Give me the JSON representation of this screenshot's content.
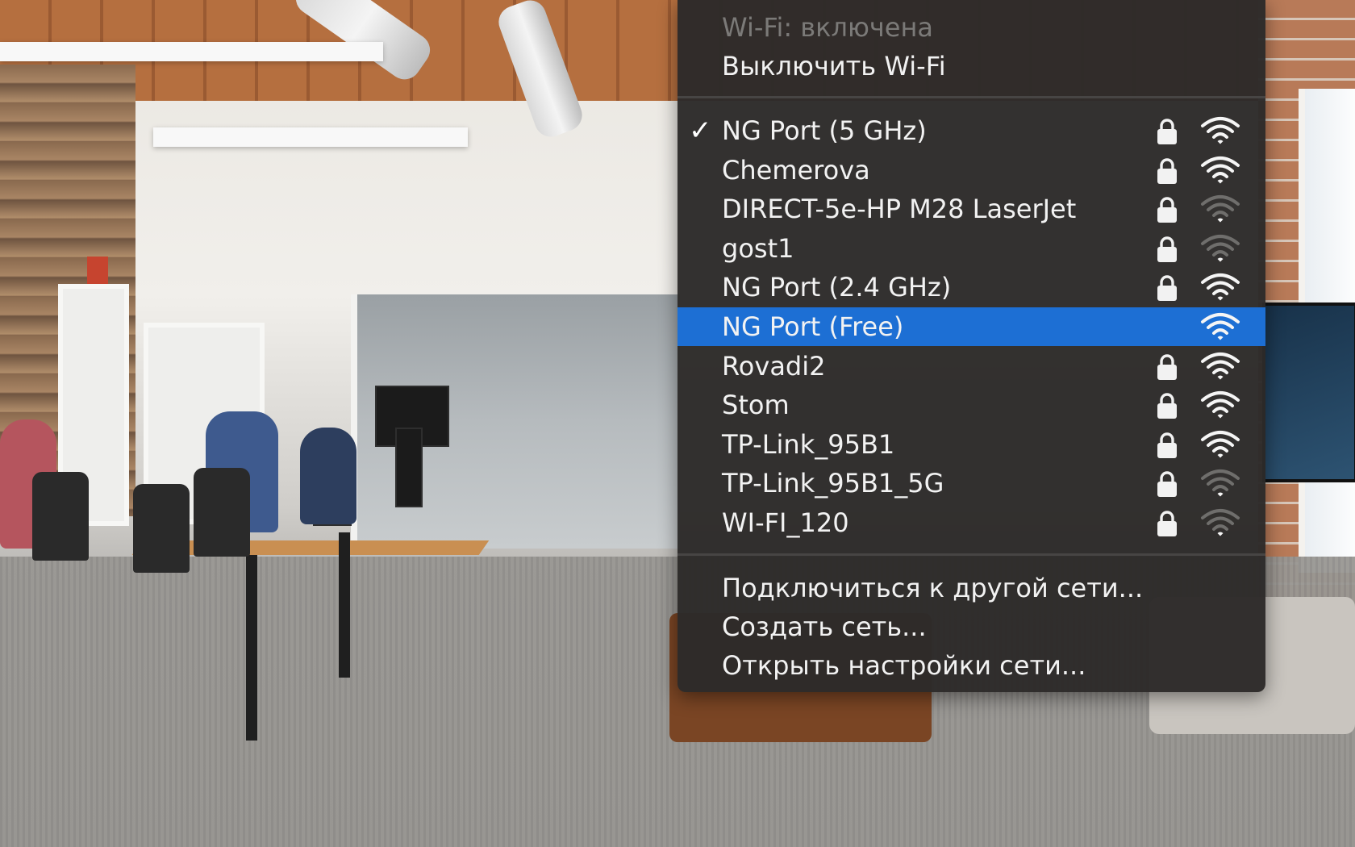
{
  "menu": {
    "status": "Wi-Fi: включена",
    "turn_off": "Выключить Wi-Fi",
    "networks": [
      {
        "name": "NG Port (5 GHz)",
        "connected": true,
        "locked": true,
        "signal": 4
      },
      {
        "name": "Chemerova",
        "connected": false,
        "locked": true,
        "signal": 4
      },
      {
        "name": "DIRECT-5e-HP M28 LaserJet",
        "connected": false,
        "locked": true,
        "signal": 1
      },
      {
        "name": "gost1",
        "connected": false,
        "locked": true,
        "signal": 1
      },
      {
        "name": "NG Port (2.4 GHz)",
        "connected": false,
        "locked": true,
        "signal": 4
      },
      {
        "name": "NG Port (Free)",
        "connected": false,
        "locked": false,
        "signal": 4,
        "highlighted": true
      },
      {
        "name": "Rovadi2",
        "connected": false,
        "locked": true,
        "signal": 4
      },
      {
        "name": "Stom",
        "connected": false,
        "locked": true,
        "signal": 4
      },
      {
        "name": "TP-Link_95B1",
        "connected": false,
        "locked": true,
        "signal": 4
      },
      {
        "name": "TP-Link_95B1_5G",
        "connected": false,
        "locked": true,
        "signal": 1
      },
      {
        "name": "WI-FI_120",
        "connected": false,
        "locked": true,
        "signal": 1
      }
    ],
    "actions": [
      "Подключиться к другой сети...",
      "Создать сеть...",
      "Открыть настройки сети..."
    ],
    "checkmark": "✓"
  },
  "colors": {
    "menu_bg": "#2c2a29",
    "highlight": "#1d6fd4",
    "text": "#f2f2f2",
    "disabled_text": "#7b7a78",
    "dim_icon": "#6f6e6c"
  }
}
